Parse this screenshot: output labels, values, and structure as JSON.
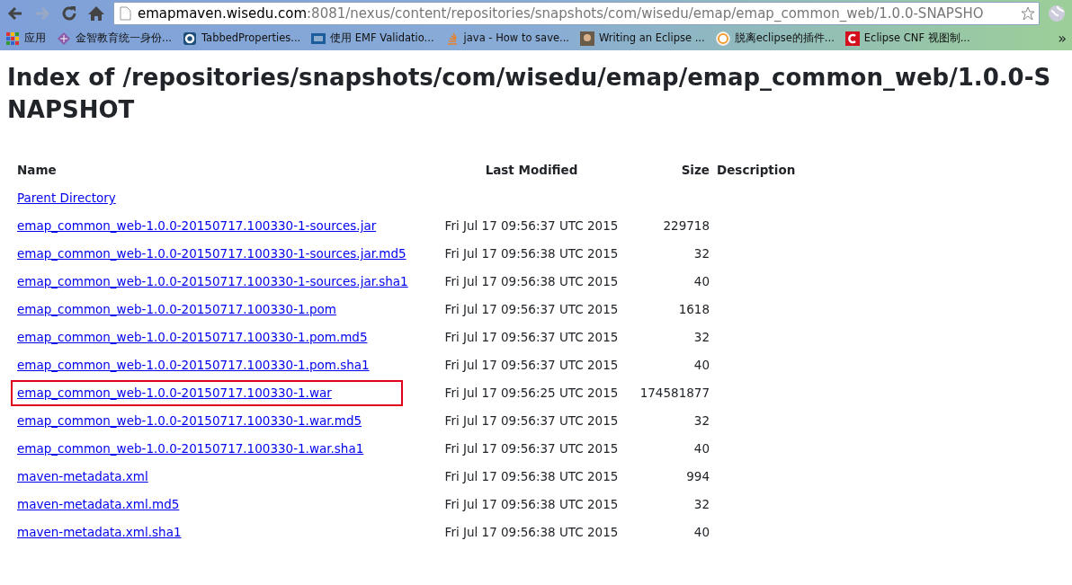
{
  "browser": {
    "address": {
      "host": "emapmaven.wisedu.com",
      "path": ":8081/nexus/content/repositories/snapshots/com/wisedu/emap/emap_common_web/1.0.0-SNAPSHO"
    },
    "bookmarks": [
      {
        "label": "应用",
        "kind": "apps"
      },
      {
        "label": "金智教育统一身份...",
        "kind": "diamond"
      },
      {
        "label": "TabbedProperties...",
        "kind": "ring"
      },
      {
        "label": "使用 EMF Validatio...",
        "kind": "square"
      },
      {
        "label": "java - How to save...",
        "kind": "stack"
      },
      {
        "label": "Writing an Eclipse ...",
        "kind": "photo"
      },
      {
        "label": "脱离eclipse的插件...",
        "kind": "smiley"
      },
      {
        "label": "Eclipse CNF 视图制...",
        "kind": "letter"
      }
    ],
    "more": "»"
  },
  "heading": "Index of /repositories/snapshots/com/wisedu/emap/emap_common_web/1.0.0-SNAPSHOT",
  "table": {
    "columns": [
      "Name",
      "Last Modified",
      "Size",
      "Description"
    ],
    "rows": [
      {
        "name": "Parent Directory",
        "modified": "",
        "size": "",
        "highlighted": false
      },
      {
        "name": "emap_common_web-1.0.0-20150717.100330-1-sources.jar",
        "modified": "Fri Jul 17 09:56:37 UTC 2015",
        "size": "229718",
        "highlighted": false
      },
      {
        "name": "emap_common_web-1.0.0-20150717.100330-1-sources.jar.md5",
        "modified": "Fri Jul 17 09:56:38 UTC 2015",
        "size": "32",
        "highlighted": false
      },
      {
        "name": "emap_common_web-1.0.0-20150717.100330-1-sources.jar.sha1",
        "modified": "Fri Jul 17 09:56:38 UTC 2015",
        "size": "40",
        "highlighted": false
      },
      {
        "name": "emap_common_web-1.0.0-20150717.100330-1.pom",
        "modified": "Fri Jul 17 09:56:37 UTC 2015",
        "size": "1618",
        "highlighted": false
      },
      {
        "name": "emap_common_web-1.0.0-20150717.100330-1.pom.md5",
        "modified": "Fri Jul 17 09:56:37 UTC 2015",
        "size": "32",
        "highlighted": false
      },
      {
        "name": "emap_common_web-1.0.0-20150717.100330-1.pom.sha1",
        "modified": "Fri Jul 17 09:56:37 UTC 2015",
        "size": "40",
        "highlighted": false
      },
      {
        "name": "emap_common_web-1.0.0-20150717.100330-1.war",
        "modified": "Fri Jul 17 09:56:25 UTC 2015",
        "size": "174581877",
        "highlighted": true
      },
      {
        "name": "emap_common_web-1.0.0-20150717.100330-1.war.md5",
        "modified": "Fri Jul 17 09:56:37 UTC 2015",
        "size": "32",
        "highlighted": false
      },
      {
        "name": "emap_common_web-1.0.0-20150717.100330-1.war.sha1",
        "modified": "Fri Jul 17 09:56:37 UTC 2015",
        "size": "40",
        "highlighted": false
      },
      {
        "name": "maven-metadata.xml",
        "modified": "Fri Jul 17 09:56:38 UTC 2015",
        "size": "994",
        "highlighted": false
      },
      {
        "name": "maven-metadata.xml.md5",
        "modified": "Fri Jul 17 09:56:38 UTC 2015",
        "size": "32",
        "highlighted": false
      },
      {
        "name": "maven-metadata.xml.sha1",
        "modified": "Fri Jul 17 09:56:38 UTC 2015",
        "size": "40",
        "highlighted": false
      }
    ]
  }
}
